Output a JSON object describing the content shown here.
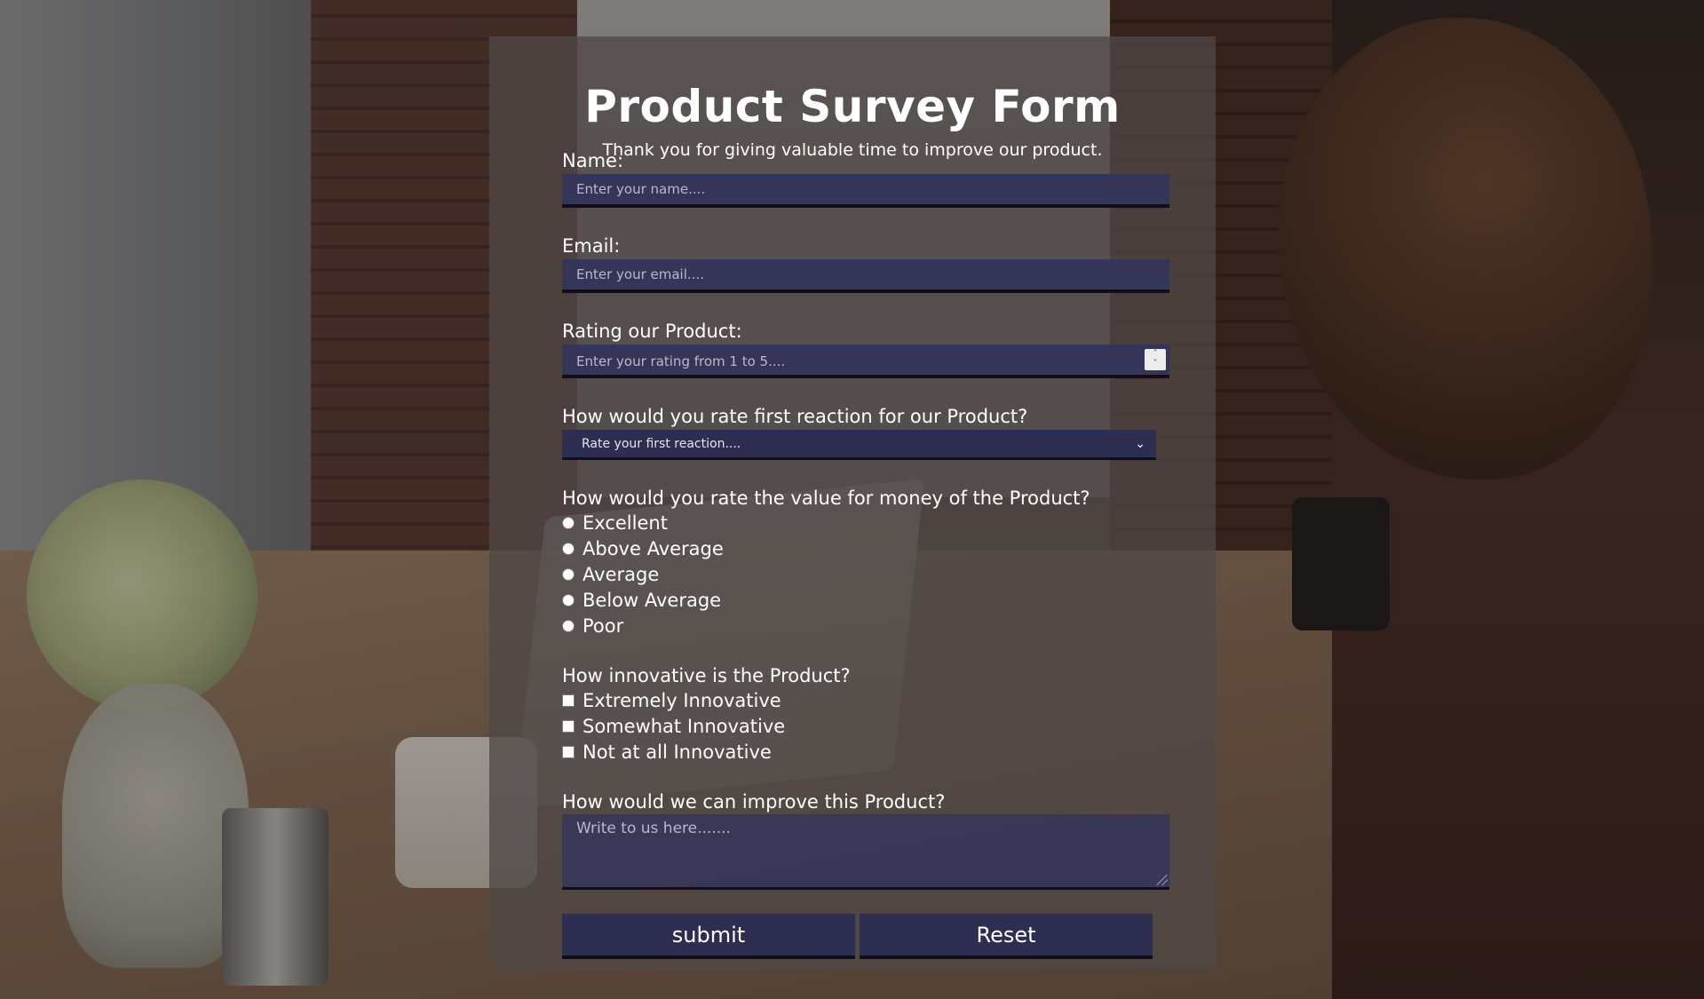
{
  "form": {
    "title": "Product Survey Form",
    "subtitle": "Thank you for giving valuable time to improve our product.",
    "name": {
      "label": "Name:",
      "placeholder": "Enter your name...."
    },
    "email": {
      "label": "Email:",
      "placeholder": "Enter your email...."
    },
    "rating": {
      "label": "Rating our Product:",
      "placeholder": "Enter your rating from 1 to 5...."
    },
    "first_reaction": {
      "label": "How would you rate first reaction for our Product?",
      "selected": "Rate your first reaction...."
    },
    "value_for_money": {
      "label": "How would you rate the value for money of the Product?",
      "options": [
        "Excellent",
        "Above Average",
        "Average",
        "Below Average",
        "Poor"
      ]
    },
    "innovative": {
      "label": "How innovative is the Product?",
      "options": [
        "Extremely Innovative",
        "Somewhat Innovative",
        "Not at all Innovative"
      ]
    },
    "improve": {
      "label": "How would we can improve this Product?",
      "placeholder": "Write to us here......."
    },
    "buttons": {
      "submit": "submit",
      "reset": "Reset"
    }
  },
  "colors": {
    "field_bg": "#35355a",
    "button_bg": "#2e2e52",
    "panel_bg": "rgba(80,72,70,0.78)"
  }
}
